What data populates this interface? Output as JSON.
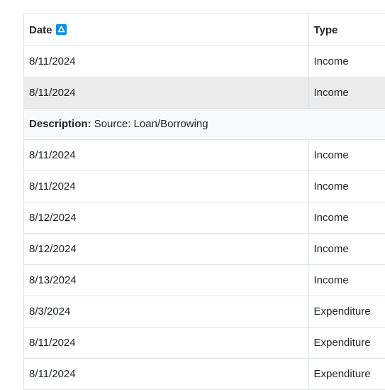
{
  "table": {
    "headers": {
      "date": "Date",
      "type": "Type"
    },
    "sort": {
      "column": "date",
      "direction": "ascending",
      "icon": "sort-ascending-icon",
      "color": "#0d8ee0"
    },
    "rows_before": [
      {
        "date": "8/11/2024",
        "type": "Income"
      },
      {
        "date": "8/11/2024",
        "type": "Income"
      }
    ],
    "detail": {
      "label": "Description:",
      "value": " Source: Loan/Borrowing"
    },
    "rows_after": [
      {
        "date": "8/11/2024",
        "type": "Income"
      },
      {
        "date": "8/11/2024",
        "type": "Income"
      },
      {
        "date": "8/12/2024",
        "type": "Income"
      },
      {
        "date": "8/12/2024",
        "type": "Income"
      },
      {
        "date": "8/13/2024",
        "type": "Income"
      },
      {
        "date": "8/3/2024",
        "type": "Expenditure"
      },
      {
        "date": "8/11/2024",
        "type": "Expenditure"
      },
      {
        "date": "8/11/2024",
        "type": "Expenditure"
      }
    ]
  }
}
